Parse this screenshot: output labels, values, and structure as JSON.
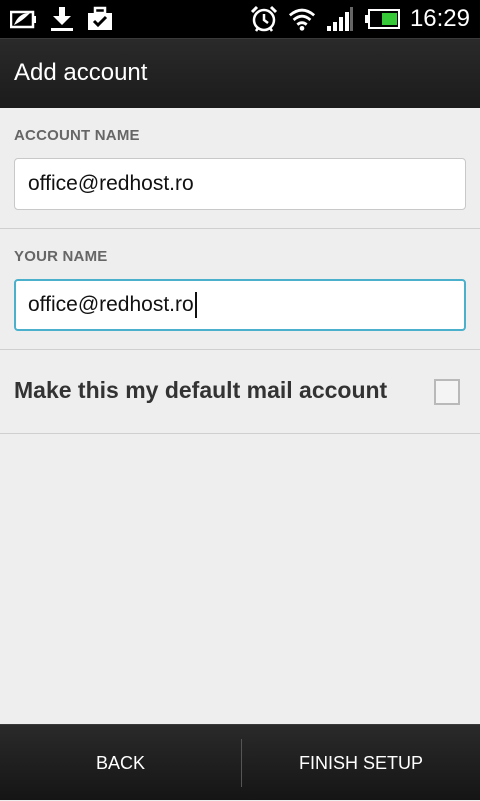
{
  "status_bar": {
    "time": "16:29",
    "left_icons": [
      "battery-saver-icon",
      "download-icon",
      "briefcase-check-icon"
    ],
    "right_icons": [
      "alarm-icon",
      "wifi-icon",
      "signal-icon",
      "battery-icon"
    ]
  },
  "action_bar": {
    "title": "Add account"
  },
  "form": {
    "account_name_label": "ACCOUNT NAME",
    "account_name_value": "office@redhost.ro",
    "your_name_label": "YOUR NAME",
    "your_name_value": "office@redhost.ro",
    "default_mail_label": "Make this my default mail account",
    "default_mail_checked": false
  },
  "bottom_bar": {
    "back_label": "BACK",
    "finish_label": "FINISH SETUP"
  },
  "colors": {
    "focus_border": "#4ab0cc",
    "background": "#eeeeee",
    "bar": "#1b1b1b"
  }
}
